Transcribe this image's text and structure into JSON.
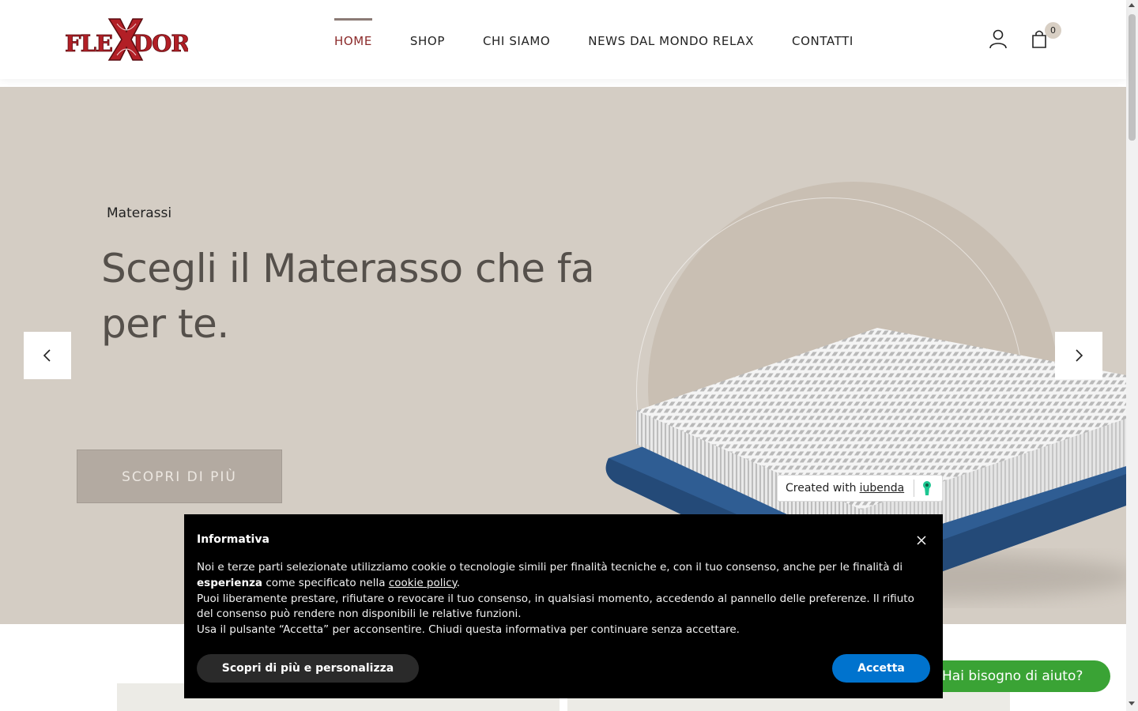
{
  "brand": {
    "logo_text": "FLEXDOR"
  },
  "nav": {
    "items": [
      {
        "label": "HOME",
        "active": true
      },
      {
        "label": "SHOP",
        "active": false
      },
      {
        "label": "CHI SIAMO",
        "active": false
      },
      {
        "label": "NEWS DAL MONDO RELAX",
        "active": false
      },
      {
        "label": "CONTATTI",
        "active": false
      }
    ],
    "cart_count": "0",
    "icons": [
      "user-icon",
      "shopping-bag-icon"
    ]
  },
  "hero": {
    "category": "Materassi",
    "title": "Scegli il Materasso che fa per te.",
    "cta": "SCOPRI DI PIÙ",
    "prev_icon": "chevron-left-icon",
    "next_icon": "chevron-right-icon"
  },
  "iubenda": {
    "prefix": "Created with",
    "link": "iubenda"
  },
  "cookie": {
    "title": "Informativa",
    "line1_a": "Noi e terze parti selezionate utilizziamo cookie o tecnologie simili per finalità tecniche e, con il tuo consenso, anche per le finalità di ",
    "line1_bold": "esperienza",
    "line1_b": " come specificato nella ",
    "line1_link": "cookie policy",
    "line1_end": ".",
    "line2": "Puoi liberamente prestare, rifiutare o revocare il tuo consenso, in qualsiasi momento, accedendo al pannello delle preferenze. Il rifiuto del consenso può rendere non disponibili le relative funzioni.",
    "line3": "Usa il pulsante “Accetta” per acconsentire. Chiudi questa informativa per continuare senza accettare.",
    "customize_label": "Scopri di più e personalizza",
    "accept_label": "Accetta"
  },
  "help": {
    "label": "Hai bisogno di aiuto?"
  },
  "colors": {
    "accent": "#8b2a2a",
    "hero_bg": "#d4cdc4",
    "accept_blue": "#0073ce",
    "help_green": "#3aa335"
  }
}
